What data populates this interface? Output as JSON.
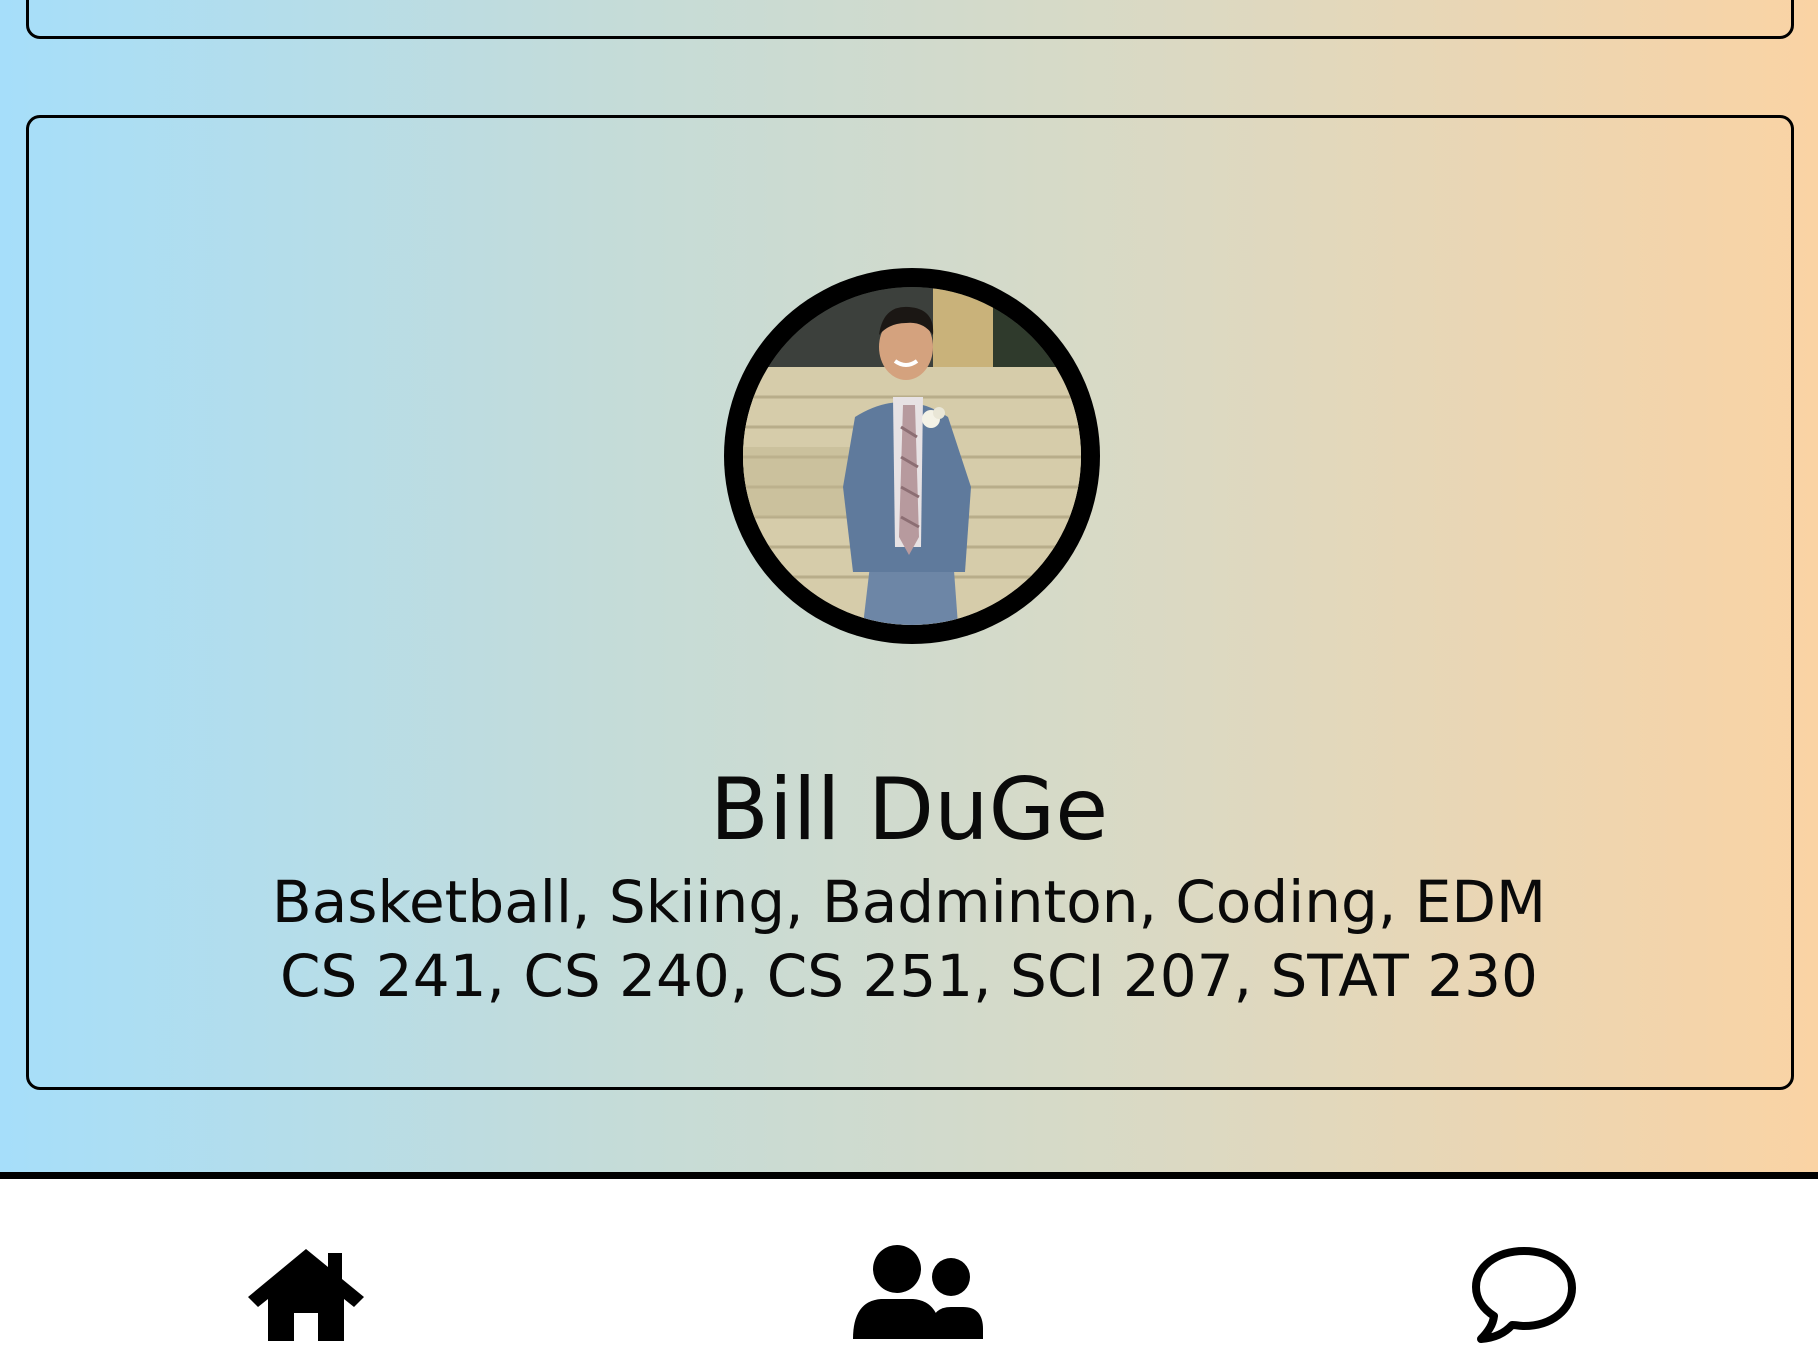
{
  "profile": {
    "name": "Bill DuGe",
    "interests": "Basketball, Skiing, Badminton, Coding, EDM",
    "courses": "CS 241, CS 240, CS 251, SCI 207, STAT 230"
  },
  "bottom_nav": {
    "items": [
      {
        "icon": "home-icon"
      },
      {
        "icon": "users-icon"
      },
      {
        "icon": "chat-bubble-icon"
      }
    ]
  },
  "colors": {
    "gradient_left": "#a6defa",
    "gradient_right": "#fad3a4",
    "border": "#000000",
    "nav_background": "#ffffff"
  }
}
